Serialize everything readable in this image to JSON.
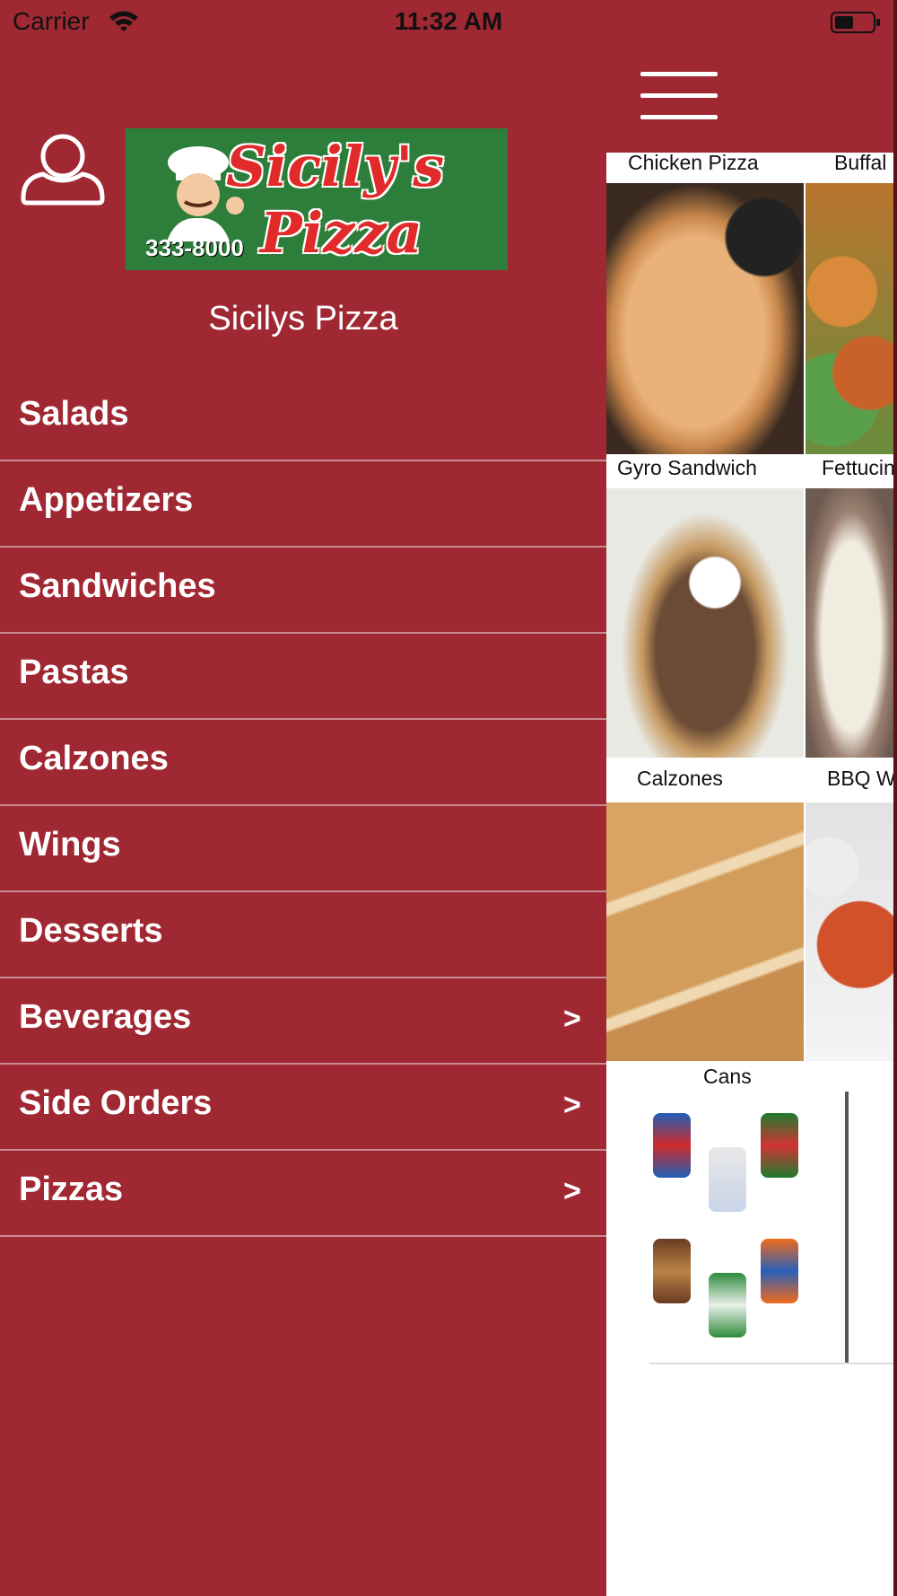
{
  "status_bar": {
    "carrier": "Carrier",
    "time": "11:32 AM"
  },
  "drawer": {
    "logo": {
      "line1": "Sicily's",
      "line2": "Pizza",
      "phone": "333-8000"
    },
    "restaurant_name": "Sicilys Pizza",
    "menu_items": [
      {
        "label": "Salads",
        "chevron": ""
      },
      {
        "label": "Appetizers",
        "chevron": ""
      },
      {
        "label": "Sandwiches",
        "chevron": ""
      },
      {
        "label": "Pastas",
        "chevron": ""
      },
      {
        "label": "Calzones",
        "chevron": ""
      },
      {
        "label": "Wings",
        "chevron": ""
      },
      {
        "label": "Desserts",
        "chevron": ""
      },
      {
        "label": "Beverages",
        "chevron": ">"
      },
      {
        "label": "Side Orders",
        "chevron": ">"
      },
      {
        "label": "Pizzas",
        "chevron": ">"
      }
    ]
  },
  "main": {
    "tiles": [
      {
        "title": "Chicken Pizza"
      },
      {
        "title": "Buffal"
      },
      {
        "title": "Gyro Sandwich"
      },
      {
        "title": "Fettucin"
      },
      {
        "title": "Calzones"
      },
      {
        "title": "BBQ W"
      },
      {
        "title": "Cans"
      }
    ]
  },
  "colors": {
    "brand": "#a02833",
    "logo_green": "#2d7e3a",
    "logo_red": "#e12a2a"
  }
}
